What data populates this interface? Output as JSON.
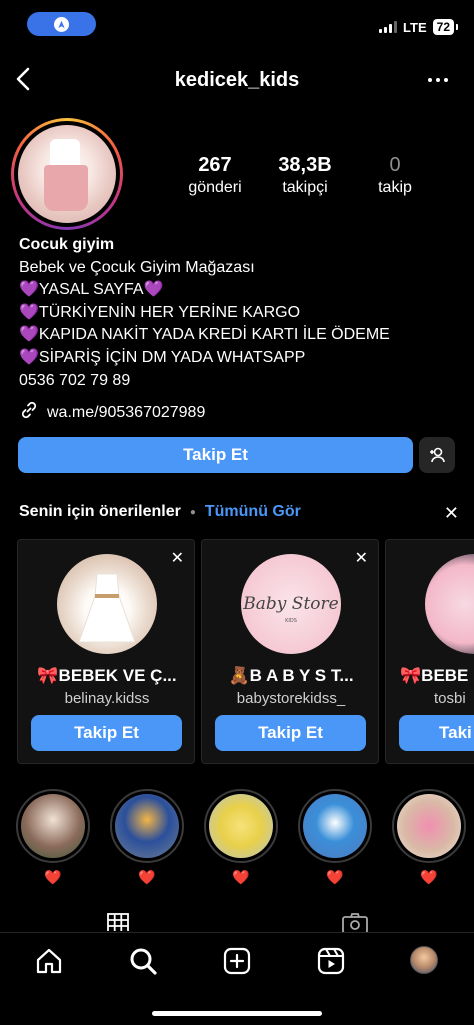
{
  "status_bar": {
    "network": "LTE",
    "battery": "72"
  },
  "header": {
    "username": "kedicek_kids"
  },
  "stats": [
    {
      "value": "267",
      "label": "gönderi"
    },
    {
      "value": "38,3B",
      "label": "takipçi"
    },
    {
      "value": "0",
      "label": "takip"
    }
  ],
  "bio": {
    "name": "Cocuk giyim",
    "lines": [
      "Bebek ve Çocuk Giyim Mağazası",
      "💜YASAL SAYFA💜",
      "💜TÜRKİYENİN HER YERİNE KARGO",
      "💜KAPIDA NAKİT YADA KREDİ KARTI İLE ÖDEME",
      "💜SİPARİŞ İÇİN DM YADA WHATSAPP",
      "0536 702 79 89"
    ],
    "link": "wa.me/905367027989"
  },
  "actions": {
    "follow_label": "Takip Et"
  },
  "suggestions": {
    "title": "Senin için önerilenler",
    "see_all": "Tümünü Gör",
    "cards": [
      {
        "name": "🎀BEBEK VE Ç...",
        "username": "belinay.kidss",
        "button": "Takip Et"
      },
      {
        "name": "🧸B A B Y   S T...",
        "username": "babystorekidss_",
        "button": "Takip Et"
      },
      {
        "name": "🎀BEBE",
        "username": "tosbi",
        "button": "Taki"
      }
    ]
  },
  "highlights": [
    {
      "label": "❤️"
    },
    {
      "label": "❤️"
    },
    {
      "label": "❤️"
    },
    {
      "label": "❤️"
    },
    {
      "label": "❤️"
    }
  ],
  "colors": {
    "accent": "#4a97f7",
    "background": "#000000"
  },
  "icons": [
    "back-icon",
    "more-icon",
    "link-icon",
    "add-person-icon",
    "close-icon",
    "grid-icon",
    "tagged-icon",
    "home-icon",
    "search-icon",
    "create-icon",
    "reels-icon",
    "profile-avatar"
  ]
}
